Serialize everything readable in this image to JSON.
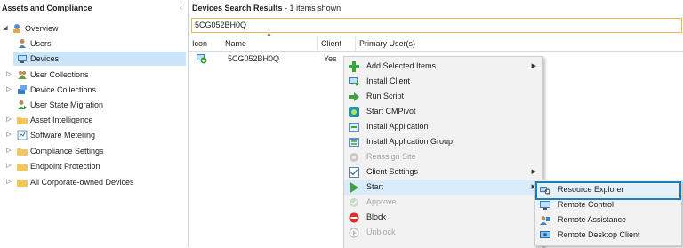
{
  "left_pane": {
    "title": "Assets and Compliance",
    "collapse_icon": "‹",
    "tree": [
      {
        "label": "Overview",
        "expander": "◢",
        "icon": "overview-icon",
        "level": 0,
        "selected": false
      },
      {
        "label": "Users",
        "expander": "",
        "icon": "users-icon",
        "level": 1,
        "selected": false
      },
      {
        "label": "Devices",
        "expander": "",
        "icon": "devices-icon",
        "level": 1,
        "selected": true
      },
      {
        "label": "User Collections",
        "expander": "▷",
        "icon": "user-collections-icon",
        "level": 1,
        "selected": false
      },
      {
        "label": "Device Collections",
        "expander": "▷",
        "icon": "device-collections-icon",
        "level": 1,
        "selected": false
      },
      {
        "label": "User State Migration",
        "expander": "",
        "icon": "user-state-migration-icon",
        "level": 1,
        "selected": false
      },
      {
        "label": "Asset Intelligence",
        "expander": "▷",
        "icon": "folder-icon",
        "level": 1,
        "selected": false
      },
      {
        "label": "Software Metering",
        "expander": "▷",
        "icon": "software-metering-icon",
        "level": 1,
        "selected": false
      },
      {
        "label": "Compliance Settings",
        "expander": "▷",
        "icon": "folder-icon",
        "level": 1,
        "selected": false
      },
      {
        "label": "Endpoint Protection",
        "expander": "▷",
        "icon": "folder-icon",
        "level": 1,
        "selected": false
      },
      {
        "label": "All Corporate-owned Devices",
        "expander": "▷",
        "icon": "folder-icon",
        "level": 1,
        "selected": false
      }
    ]
  },
  "right_pane": {
    "title_bold": "Devices Search Results",
    "title_rest": " -  1 items shown",
    "search_value": "5CG052BH0Q",
    "columns": [
      "Icon",
      "Name",
      "Client",
      "Primary User(s)"
    ],
    "rows": [
      {
        "icon": "device-client-icon",
        "name": "5CG052BH0Q",
        "client": "Yes",
        "primary_users": ""
      }
    ]
  },
  "context_menu": {
    "items": [
      {
        "label": "Add Selected Items",
        "icon": "add-icon",
        "disabled": false,
        "submenu": true
      },
      {
        "label": "Install Client",
        "icon": "install-client-icon",
        "disabled": false,
        "submenu": false
      },
      {
        "label": "Run Script",
        "icon": "run-script-icon",
        "disabled": false,
        "submenu": false
      },
      {
        "label": "Start CMPivot",
        "icon": "cmpivot-icon",
        "disabled": false,
        "submenu": false
      },
      {
        "label": "Install Application",
        "icon": "install-application-icon",
        "disabled": false,
        "submenu": false
      },
      {
        "label": "Install Application Group",
        "icon": "install-application-group-icon",
        "disabled": false,
        "submenu": false
      },
      {
        "label": "Reassign Site",
        "icon": "reassign-site-icon",
        "disabled": true,
        "submenu": false
      },
      {
        "label": "Client Settings",
        "icon": "client-settings-icon",
        "disabled": false,
        "submenu": true
      },
      {
        "label": "Start",
        "icon": "start-icon",
        "disabled": false,
        "submenu": true,
        "highlighted": true
      },
      {
        "label": "Approve",
        "icon": "approve-icon",
        "disabled": true,
        "submenu": false
      },
      {
        "label": "Block",
        "icon": "block-icon",
        "disabled": false,
        "submenu": false
      },
      {
        "label": "Unblock",
        "icon": "unblock-icon",
        "disabled": true,
        "submenu": false
      }
    ],
    "submenu_arrow": "▶"
  },
  "start_submenu": {
    "items": [
      {
        "label": "Resource Explorer",
        "icon": "resource-explorer-icon",
        "highlighted": true
      },
      {
        "label": "Remote Control",
        "icon": "remote-control-icon",
        "highlighted": false
      },
      {
        "label": "Remote Assistance",
        "icon": "remote-assistance-icon",
        "highlighted": false
      },
      {
        "label": "Remote Desktop Client",
        "icon": "remote-desktop-client-icon",
        "highlighted": false
      }
    ]
  },
  "colors": {
    "selection": "#cce4f7",
    "search_border": "#e8b94a",
    "highlight_border": "#1a7fb8",
    "folder": "#f2c75c"
  }
}
